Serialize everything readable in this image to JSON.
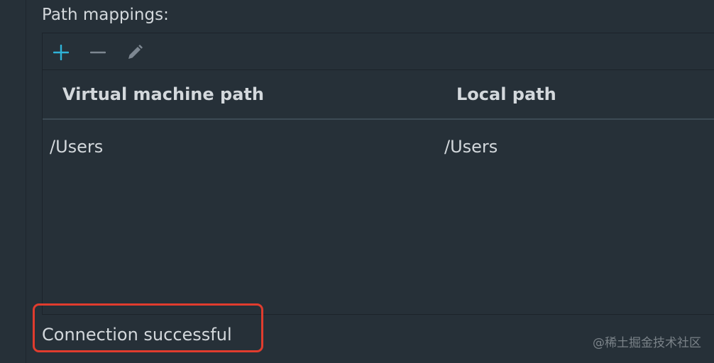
{
  "section": {
    "label": "Path mappings:"
  },
  "toolbar": {
    "add_icon": "plus-icon",
    "remove_icon": "minus-icon",
    "edit_icon": "pencil-icon",
    "accent_color": "#2fb3d8",
    "muted_color": "#7d8791"
  },
  "table": {
    "columns": [
      "Virtual machine path",
      "Local path"
    ],
    "rows": [
      {
        "vm_path": "/Users",
        "local_path": "/Users"
      }
    ]
  },
  "status": {
    "text": "Connection successful",
    "highlight_color": "#e03c2e"
  },
  "watermark": {
    "text": "@稀土掘金技术社区"
  }
}
